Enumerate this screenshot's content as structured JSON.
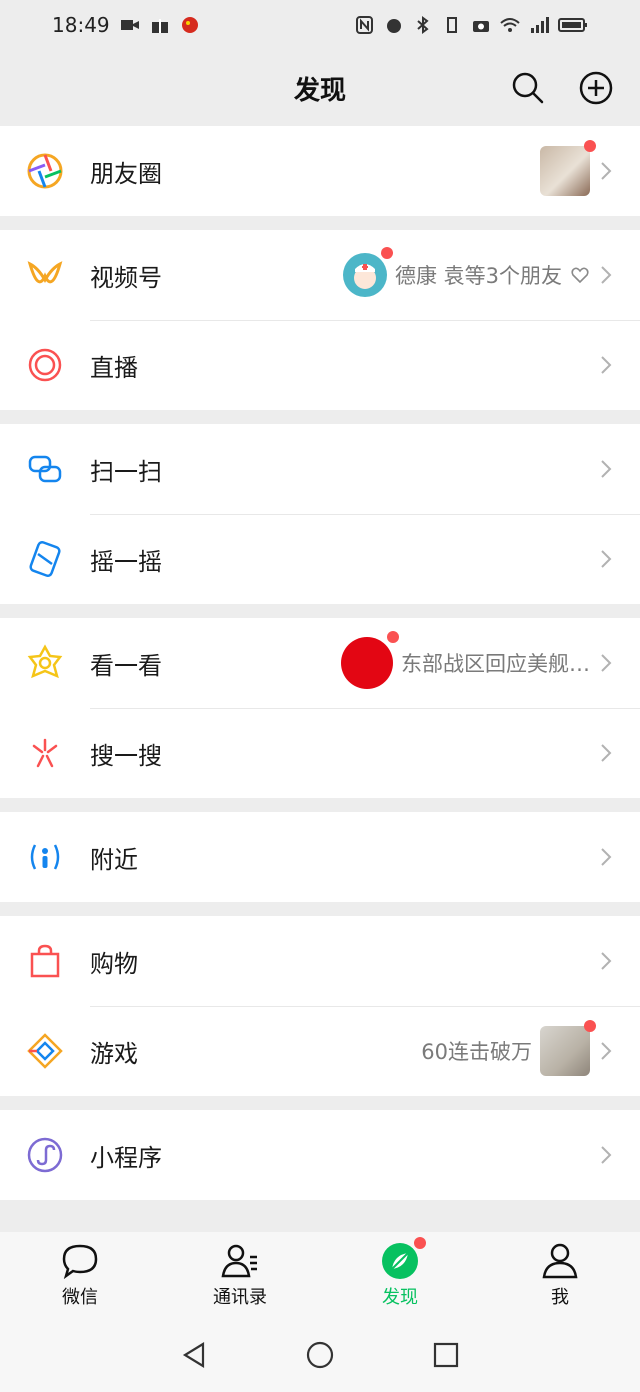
{
  "status": {
    "time": "18:49"
  },
  "header": {
    "title": "发现"
  },
  "groups": [
    {
      "items": [
        {
          "label": "朋友圈"
        }
      ]
    },
    {
      "items": [
        {
          "label": "视频号",
          "meta": "德康 袁等3个朋友"
        },
        {
          "label": "直播"
        }
      ]
    },
    {
      "items": [
        {
          "label": "扫一扫"
        },
        {
          "label": "摇一摇"
        }
      ]
    },
    {
      "items": [
        {
          "label": "看一看",
          "meta": "东部战区回应美舰…"
        },
        {
          "label": "搜一搜"
        }
      ]
    },
    {
      "items": [
        {
          "label": "附近"
        }
      ]
    },
    {
      "items": [
        {
          "label": "购物"
        },
        {
          "label": "游戏",
          "meta": "60连击破万"
        }
      ]
    },
    {
      "items": [
        {
          "label": "小程序"
        }
      ]
    }
  ],
  "tabs": [
    {
      "label": "微信"
    },
    {
      "label": "通讯录"
    },
    {
      "label": "发现",
      "active": true
    },
    {
      "label": "我"
    }
  ],
  "colors": {
    "accent": "#07c160",
    "badge": "#fa5151"
  }
}
